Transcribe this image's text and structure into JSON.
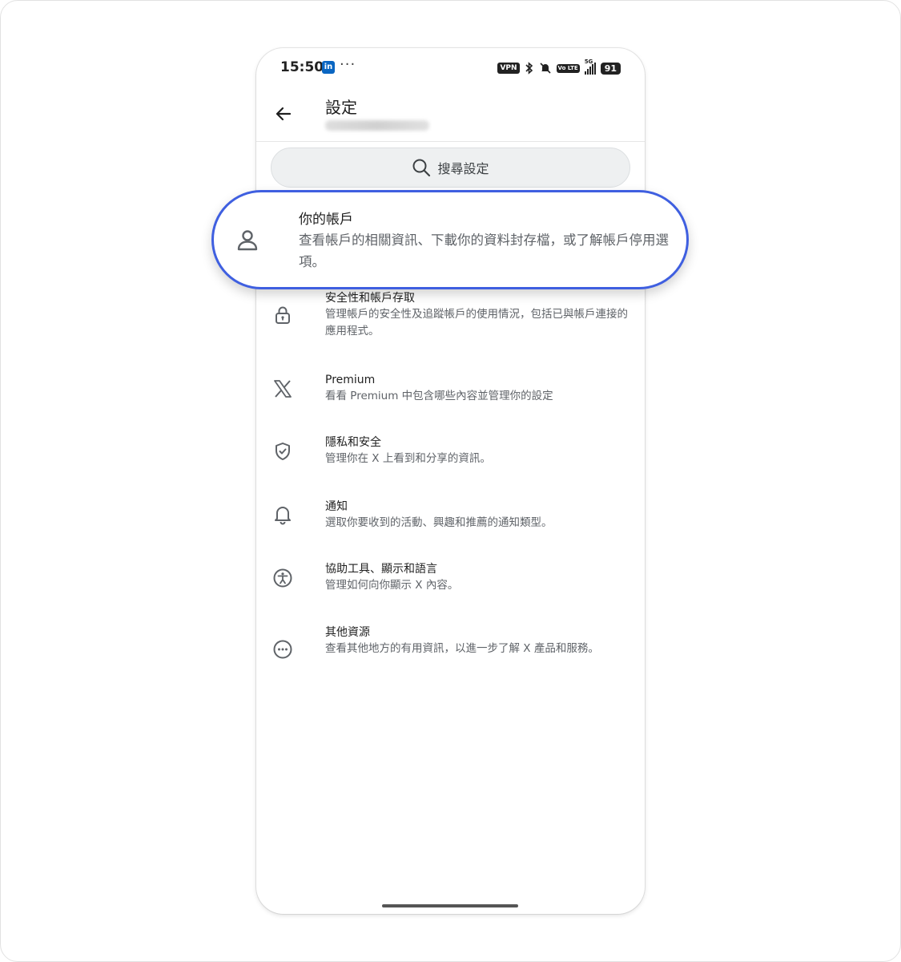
{
  "status_bar": {
    "time": "15:50",
    "linkedin_badge": "in",
    "more": "···",
    "vpn": "VPN",
    "volte": "Vo LTE",
    "network": "5G",
    "battery": "91"
  },
  "header": {
    "title": "設定"
  },
  "search": {
    "placeholder": "搜尋設定"
  },
  "highlighted_item": {
    "title": "你的帳戶",
    "description": "查看帳戶的相關資訊、下載你的資料封存檔，或了解帳戶停用選項。",
    "icon": "person-icon"
  },
  "items": [
    {
      "title": "安全性和帳戶存取",
      "description": "管理帳戶的安全性及追蹤帳戶的使用情況，包括已與帳戶連接的應用程式。",
      "icon": "lock-icon"
    },
    {
      "title": "Premium",
      "description": "看看 Premium 中包含哪些內容並管理你的設定",
      "icon": "x-logo-icon"
    },
    {
      "title": "隱私和安全",
      "description": "管理你在 X 上看到和分享的資訊。",
      "icon": "shield-check-icon"
    },
    {
      "title": "通知",
      "description": "選取你要收到的活動、興趣和推薦的通知類型。",
      "icon": "bell-icon"
    },
    {
      "title": "協助工具、顯示和語言",
      "description": "管理如何向你顯示 X 內容。",
      "icon": "accessibility-icon"
    },
    {
      "title": "其他資源",
      "description": "查看其他地方的有用資訊，以進一步了解 X 產品和服務。",
      "icon": "more-circle-icon"
    }
  ],
  "colors": {
    "highlight_border": "#3f5fe0",
    "icon": "#5f6368"
  }
}
